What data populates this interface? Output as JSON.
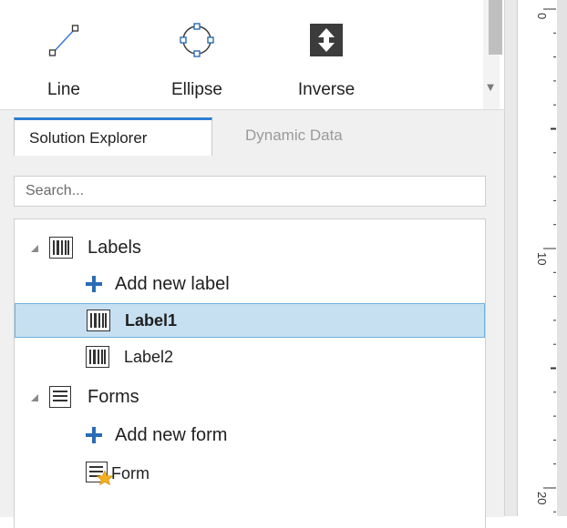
{
  "toolbar": {
    "tools": [
      {
        "label": "Line",
        "icon": "line-tool-icon"
      },
      {
        "label": "Ellipse",
        "icon": "ellipse-tool-icon"
      },
      {
        "label": "Inverse",
        "icon": "inverse-tool-icon"
      }
    ]
  },
  "ruler": {
    "marks": [
      "0",
      "10",
      "20"
    ]
  },
  "tabs": [
    {
      "label": "Solution Explorer",
      "active": true
    },
    {
      "label": "Dynamic Data",
      "active": false
    }
  ],
  "search": {
    "placeholder": "Search..."
  },
  "tree": {
    "labels_group": "Labels",
    "add_label": "Add new label",
    "label1": "Label1",
    "label2": "Label2",
    "forms_group": "Forms",
    "add_form": "Add new form",
    "form": "Form"
  },
  "colors": {
    "accent": "#2d7dd2",
    "selection_bg": "#c7e0f1",
    "selection_border": "#6fb0dd",
    "plus_icon": "#2a6cb5",
    "star_icon": "#f2b01e"
  }
}
